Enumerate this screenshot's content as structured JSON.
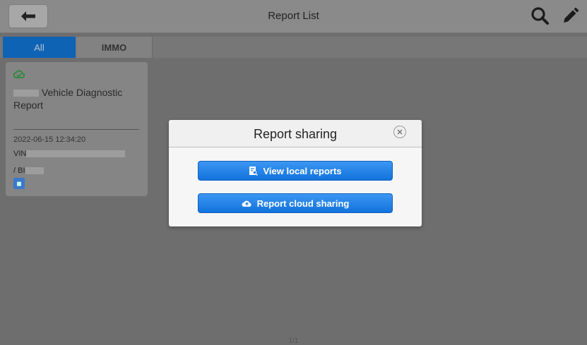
{
  "header": {
    "title": "Report List",
    "back_icon": "back-arrow-icon",
    "search_icon": "search-icon",
    "edit_icon": "pencil-icon"
  },
  "tabs": [
    {
      "label": "All",
      "active": true
    },
    {
      "label": "IMMO",
      "active": false
    }
  ],
  "report_card": {
    "title": "Vehicle Diagnostic Report",
    "date": "2022-06-15 12:34:20",
    "vin_prefix": "VIN",
    "bl_prefix": "/ BI",
    "status_icon": "cloud-check-icon"
  },
  "pager": "1/1",
  "dialog": {
    "title": "Report sharing",
    "close_icon": "close-circle-icon",
    "buttons": [
      {
        "label": "View local reports",
        "icon": "local-report-icon"
      },
      {
        "label": "Report cloud sharing",
        "icon": "cloud-upload-icon"
      }
    ]
  },
  "colors": {
    "tab_active": "#0f63b5",
    "button_blue": "#1a7ae3",
    "overlay_gray": "#6e6e6e"
  }
}
